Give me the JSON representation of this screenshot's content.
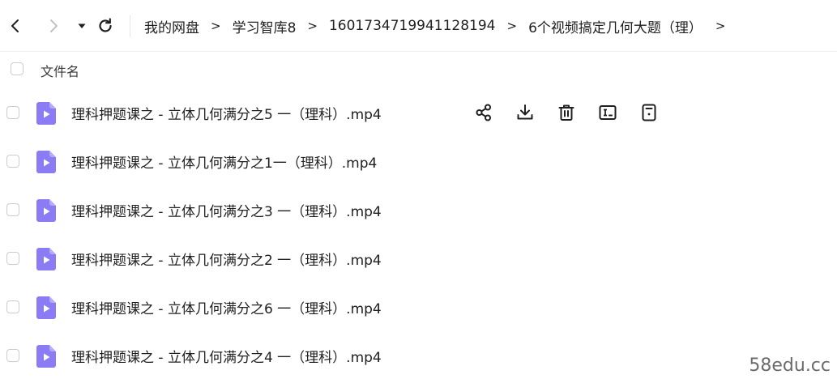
{
  "breadcrumb": [
    "我的网盘",
    "学习智库8",
    "1601734719941128194",
    "6个视频搞定几何大题（理）"
  ],
  "breadcrumb_separator": ">",
  "header": {
    "column_name": "文件名"
  },
  "files": [
    {
      "name": "理科押题课之 - 立体几何满分之5 一（理科）.mp4"
    },
    {
      "name": "理科押题课之 - 立体几何满分之1一（理科）.mp4"
    },
    {
      "name": "理科押题课之 - 立体几何满分之3 一（理科）.mp4"
    },
    {
      "name": "理科押题课之 - 立体几何满分之2 一（理科）.mp4"
    },
    {
      "name": "理科押题课之 - 立体几何满分之6 一（理科）.mp4"
    },
    {
      "name": "理科押题课之 - 立体几何满分之4 一（理科）.mp4"
    }
  ],
  "hovered_row_actions": [
    "share-icon",
    "download-icon",
    "delete-icon",
    "rename-icon",
    "details-icon"
  ],
  "icons": {
    "back": "chevron-left-icon",
    "forward": "chevron-right-icon",
    "history": "caret-down-icon",
    "refresh": "refresh-icon",
    "file": "video-file-icon"
  },
  "colors": {
    "file_icon": "#8b7cf6",
    "text": "#1f1f1f",
    "muted": "#c8cacd"
  },
  "watermark": "58edu.cc"
}
